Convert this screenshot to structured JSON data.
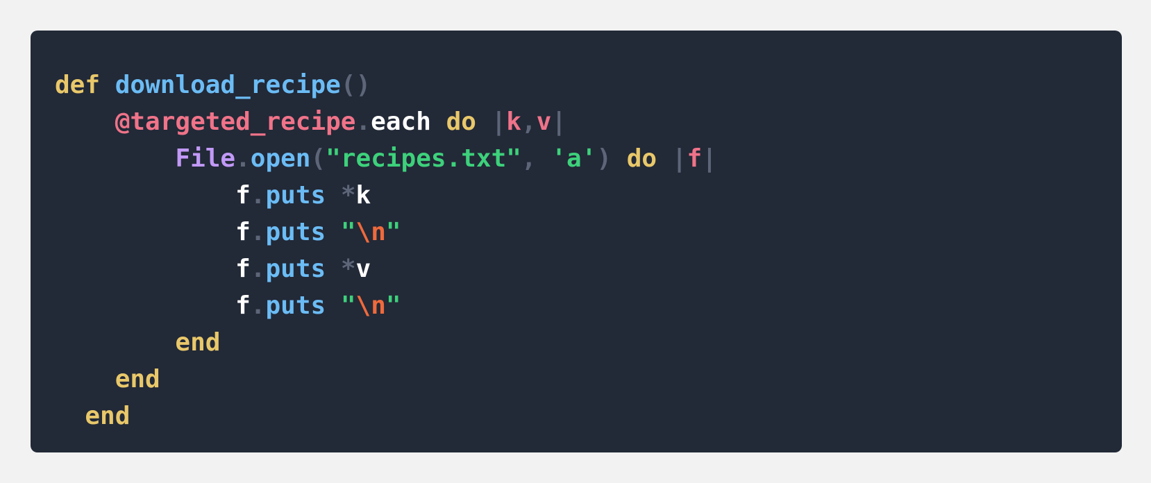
{
  "code": {
    "language": "ruby",
    "lines": [
      {
        "indent": "",
        "tokens": [
          {
            "text": "def",
            "type": "keyword"
          },
          {
            "text": " ",
            "type": "space"
          },
          {
            "text": "download_recipe",
            "type": "function"
          },
          {
            "text": "()",
            "type": "punctuation"
          }
        ]
      },
      {
        "indent": "    ",
        "tokens": [
          {
            "text": "@targeted_recipe",
            "type": "ivar"
          },
          {
            "text": ".",
            "type": "punctuation"
          },
          {
            "text": "each",
            "type": "plain"
          },
          {
            "text": " ",
            "type": "space"
          },
          {
            "text": "do",
            "type": "keyword"
          },
          {
            "text": " ",
            "type": "space"
          },
          {
            "text": "|",
            "type": "punctuation"
          },
          {
            "text": "k",
            "type": "ivar"
          },
          {
            "text": ",",
            "type": "punctuation"
          },
          {
            "text": "v",
            "type": "ivar"
          },
          {
            "text": "|",
            "type": "punctuation"
          }
        ]
      },
      {
        "indent": "        ",
        "tokens": [
          {
            "text": "File",
            "type": "class"
          },
          {
            "text": ".",
            "type": "punctuation"
          },
          {
            "text": "open",
            "type": "function"
          },
          {
            "text": "(",
            "type": "punctuation"
          },
          {
            "text": "\"recipes.txt\"",
            "type": "string"
          },
          {
            "text": ", ",
            "type": "punctuation"
          },
          {
            "text": "'a'",
            "type": "string"
          },
          {
            "text": ")",
            "type": "punctuation"
          },
          {
            "text": " ",
            "type": "space"
          },
          {
            "text": "do",
            "type": "keyword"
          },
          {
            "text": " ",
            "type": "space"
          },
          {
            "text": "|",
            "type": "punctuation"
          },
          {
            "text": "f",
            "type": "ivar"
          },
          {
            "text": "|",
            "type": "punctuation"
          }
        ]
      },
      {
        "indent": "            ",
        "tokens": [
          {
            "text": "f",
            "type": "plain"
          },
          {
            "text": ".",
            "type": "punctuation"
          },
          {
            "text": "puts",
            "type": "function"
          },
          {
            "text": " ",
            "type": "space"
          },
          {
            "text": "*",
            "type": "punctuation"
          },
          {
            "text": "k",
            "type": "plain"
          }
        ]
      },
      {
        "indent": "            ",
        "tokens": [
          {
            "text": "f",
            "type": "plain"
          },
          {
            "text": ".",
            "type": "punctuation"
          },
          {
            "text": "puts",
            "type": "function"
          },
          {
            "text": " ",
            "type": "space"
          },
          {
            "text": "\"",
            "type": "string"
          },
          {
            "text": "\\n",
            "type": "escape"
          },
          {
            "text": "\"",
            "type": "string"
          }
        ]
      },
      {
        "indent": "            ",
        "tokens": [
          {
            "text": "f",
            "type": "plain"
          },
          {
            "text": ".",
            "type": "punctuation"
          },
          {
            "text": "puts",
            "type": "function"
          },
          {
            "text": " ",
            "type": "space"
          },
          {
            "text": "*",
            "type": "punctuation"
          },
          {
            "text": "v",
            "type": "plain"
          }
        ]
      },
      {
        "indent": "            ",
        "tokens": [
          {
            "text": "f",
            "type": "plain"
          },
          {
            "text": ".",
            "type": "punctuation"
          },
          {
            "text": "puts",
            "type": "function"
          },
          {
            "text": " ",
            "type": "space"
          },
          {
            "text": "\"",
            "type": "string"
          },
          {
            "text": "\\n",
            "type": "escape"
          },
          {
            "text": "\"",
            "type": "string"
          }
        ]
      },
      {
        "indent": "        ",
        "tokens": [
          {
            "text": "end",
            "type": "keyword"
          }
        ]
      },
      {
        "indent": "    ",
        "tokens": [
          {
            "text": "end",
            "type": "keyword"
          }
        ]
      },
      {
        "indent": "  ",
        "tokens": [
          {
            "text": "end",
            "type": "keyword"
          }
        ]
      }
    ]
  },
  "colors": {
    "page_background": "#f2f2f2",
    "code_background": "#222937",
    "keyword": "#e9c86a",
    "function": "#6bbcf5",
    "punctuation": "#5d6678",
    "ivar": "#f07389",
    "class": "#c199f6",
    "string": "#3dd17b",
    "escape": "#ef6a3c",
    "plain": "#ffffff"
  }
}
